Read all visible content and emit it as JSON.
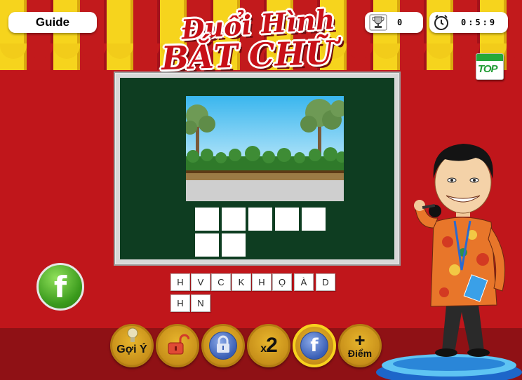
{
  "header": {
    "guide_label": "Guide",
    "score": "0",
    "timer": "0:5:9",
    "logo_line1": "Đuổi Hình",
    "logo_line2": "BẮT CHỮ",
    "top_badge": "TOP"
  },
  "tiles": {
    "row1": [
      "H",
      "V",
      "C",
      "K",
      "H",
      "Ọ",
      "À",
      "D"
    ],
    "row2": [
      "H",
      "N"
    ]
  },
  "toolbar": {
    "hint_label": "Gợi Ý",
    "double_label": "x2",
    "double_num": "2",
    "points_plus": "+",
    "points_label": "Điểm"
  },
  "colors": {
    "background": "#c0161b",
    "board": "#0e3d21",
    "awning_yellow": "#f6d41d",
    "awning_red": "#c21a1c",
    "button_gold": "#c8901a",
    "facebook_green": "#3a9a1c",
    "facebook_blue": "#3a5fb5"
  },
  "icons": {
    "score": "trophy-icon",
    "timer": "clock-icon",
    "share": "facebook-icon",
    "hint": "lightbulb-icon",
    "open": "unlock-icon",
    "lock": "lock-icon"
  }
}
